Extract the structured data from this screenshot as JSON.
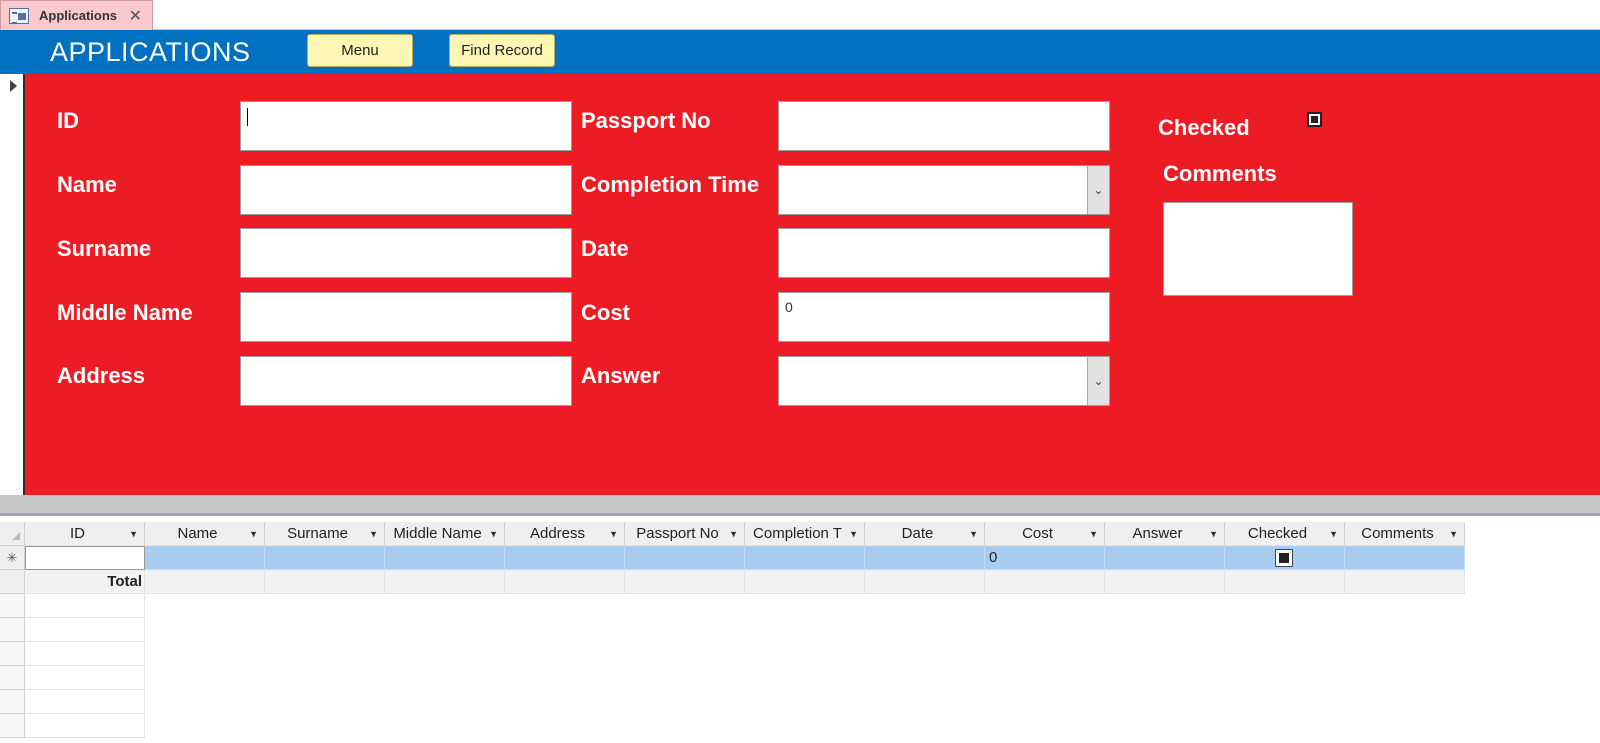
{
  "tab": {
    "title": "Applications",
    "close_glyph": "✕"
  },
  "header": {
    "title": "APPLICATIONS",
    "menu_label": "Menu",
    "find_label": "Find Record",
    "color": "#0070c0"
  },
  "form": {
    "background": "#ed1c24",
    "labels": {
      "id": "ID",
      "name": "Name",
      "surname": "Surname",
      "middle_name": "Middle Name",
      "address": "Address",
      "passport_no": "Passport No",
      "completion_time": "Completion Time",
      "date": "Date",
      "cost": "Cost",
      "answer": "Answer",
      "checked": "Checked",
      "comments": "Comments"
    },
    "values": {
      "cost": "0"
    }
  },
  "datasheet": {
    "columns": [
      "ID",
      "Name",
      "Surname",
      "Middle Name",
      "Address",
      "Passport No",
      "Completion T",
      "Date",
      "Cost",
      "Answer",
      "Checked",
      "Comments"
    ],
    "new_row_marker": "✳",
    "new_row_cost": "0",
    "total_label": "Total"
  }
}
